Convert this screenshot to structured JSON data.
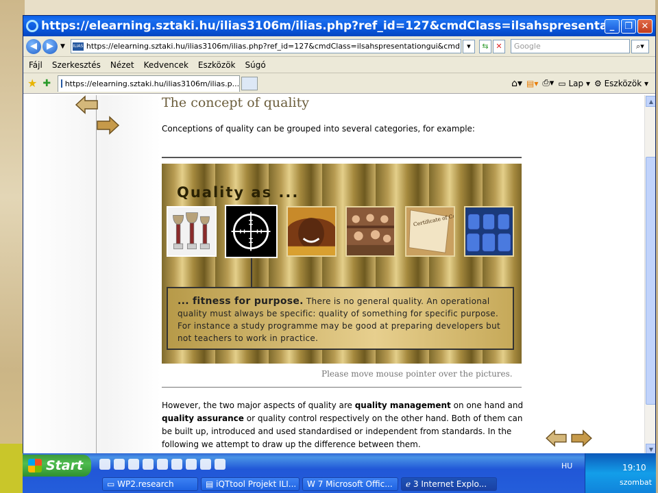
{
  "browser": {
    "title": "https://elearning.sztaki.hu/ilias3106m/ilias.php?ref_id=127&cmdClass=ilsahspresentationgui&cmdN ...",
    "address": "https://elearning.sztaki.hu/ilias3106m/ilias.php?ref_id=127&cmdClass=ilsahspresentationgui&cmdNode=",
    "favicon_text": "ILIAS",
    "search_placeholder": "Google",
    "menu": [
      "Fájl",
      "Szerkesztés",
      "Nézet",
      "Kedvencek",
      "Eszközök",
      "Súgó"
    ],
    "tab_title": "https://elearning.sztaki.hu/ilias3106m/ilias.p...",
    "toolbar": {
      "page_label": "Lap",
      "tools_label": "Eszközök"
    }
  },
  "page": {
    "title": "The concept of quality",
    "intro": "Conceptions of quality can be grouped into several categories, for example:",
    "banner_title": "Quality as ...",
    "box_bold": "... fitness for purpose.",
    "box_text": "There is no general quality. An operational quality must always be specific: quality of something for specific purpose. For instance a study programme may be good at preparing developers but not teachers to work in practice.",
    "hint": "Please move mouse pointer over the pictures.",
    "para_1": "However, the two major aspects of quality are ",
    "para_bold_1": "quality management",
    "para_2": " on one hand and ",
    "para_bold_2": "quality assurance",
    "para_3": " or quality control respectively on the other hand. Both of them can be built up, introduced and used standardised or independent from standards. In the following we attempt to draw up the difference between them.",
    "pictures": [
      "trophies",
      "crosshair",
      "smiling woman",
      "students",
      "certificate",
      "seats"
    ],
    "certificate_text": "Certificate of Completion"
  },
  "taskbar": {
    "start": "Start",
    "items": [
      "WP2.research",
      "iQTtool Projekt ILI...",
      "7 Microsoft Offic...",
      "3 Internet Explo..."
    ],
    "lang": "HU",
    "time": "19:10",
    "day": "szombat"
  }
}
